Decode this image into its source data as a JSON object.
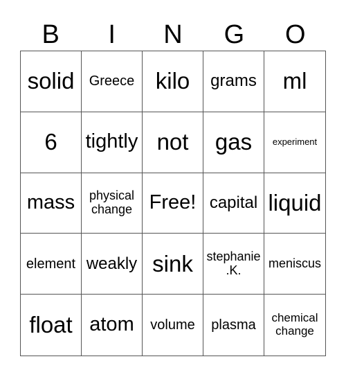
{
  "header": {
    "letters": [
      "B",
      "I",
      "N",
      "G",
      "O"
    ]
  },
  "board": {
    "cells": [
      {
        "text": "solid"
      },
      {
        "text": "Greece"
      },
      {
        "text": "kilo"
      },
      {
        "text": "grams"
      },
      {
        "text": "ml"
      },
      {
        "text": "6"
      },
      {
        "text": "tightly"
      },
      {
        "text": "not"
      },
      {
        "text": "gas"
      },
      {
        "text": "experiment"
      },
      {
        "text": "mass"
      },
      {
        "text": "physical\nchange"
      },
      {
        "text": "Free!"
      },
      {
        "text": "capital"
      },
      {
        "text": "liquid"
      },
      {
        "text": "element"
      },
      {
        "text": "weakly"
      },
      {
        "text": "sink"
      },
      {
        "text": "stephanie\n.K."
      },
      {
        "text": "meniscus"
      },
      {
        "text": "float"
      },
      {
        "text": "atom"
      },
      {
        "text": "volume"
      },
      {
        "text": "plasma"
      },
      {
        "text": "chemical\nchange"
      }
    ]
  }
}
